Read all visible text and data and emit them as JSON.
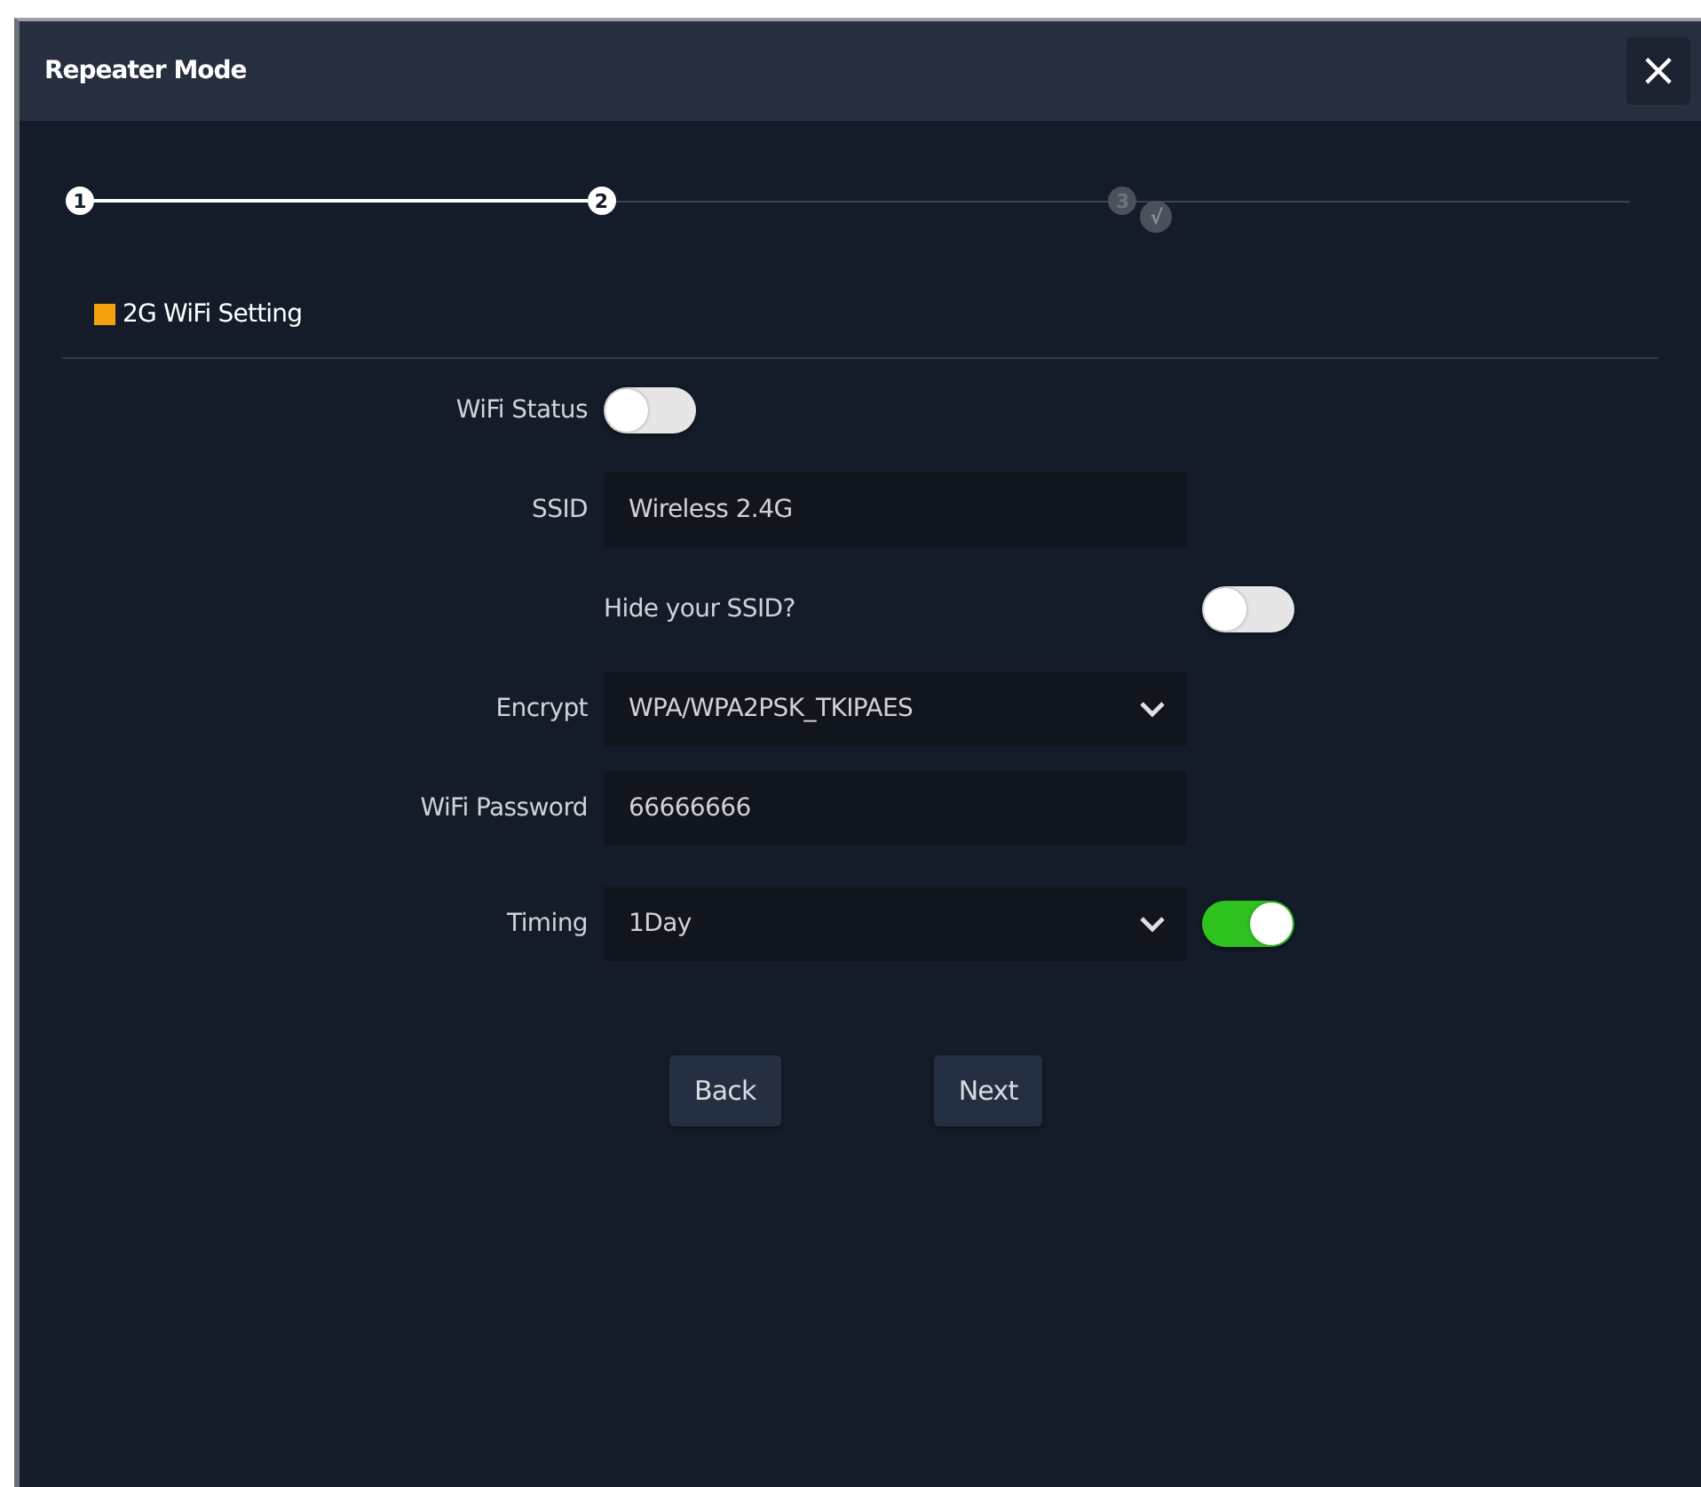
{
  "dialog": {
    "title": "Repeater Mode",
    "close": "×"
  },
  "steps": [
    {
      "label": "1",
      "reached": true
    },
    {
      "label": "2",
      "reached": true
    },
    {
      "label": "3",
      "reached": false,
      "badge": "√"
    }
  ],
  "section": {
    "title": "2G WiFi Setting",
    "color": "#f5a00f"
  },
  "fields": [
    {
      "kind": "toggle",
      "label": "WiFi Status",
      "on": false
    },
    {
      "kind": "input",
      "label": "SSID",
      "value": "Wireless 2.4G"
    },
    {
      "kind": "check",
      "text": "Hide your SSID?",
      "on": false
    },
    {
      "kind": "select",
      "label": "Encrypt",
      "value": "WPA/WPA2PSK_TKIPAES"
    },
    {
      "kind": "input",
      "label": "WiFi Password",
      "value": "66666666"
    },
    {
      "kind": "select",
      "label": "Timing",
      "value": "1Day",
      "switch": {
        "on": true
      }
    }
  ],
  "buttons": [
    "Back",
    "Next"
  ]
}
